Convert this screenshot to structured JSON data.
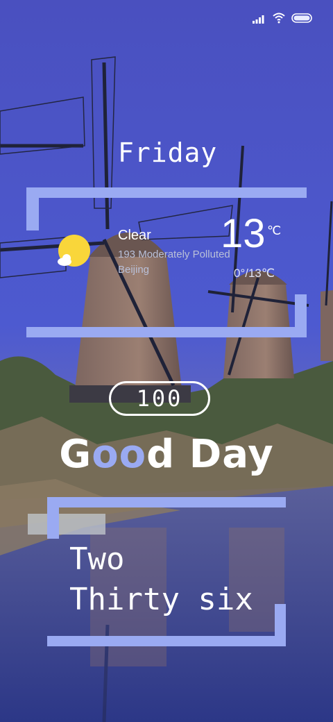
{
  "status_bar": {
    "signal_icon": "signal-bars-icon",
    "wifi_icon": "wifi-icon",
    "battery_icon": "battery-icon"
  },
  "widget": {
    "day": "Friday",
    "condition": "Clear",
    "air_quality": "193  Moderately Polluted",
    "city": "Beijing",
    "temperature": "13",
    "temperature_unit": "℃",
    "range": "0°/13℃",
    "weather_icon": "sun-cloud-icon",
    "battery_level": "100",
    "greeting": {
      "part1": "G",
      "highlight": "oo",
      "part2": "d Day"
    },
    "time_line1": "Two",
    "time_line2": "Thirty six",
    "accent_color": "#9aaaf2"
  }
}
